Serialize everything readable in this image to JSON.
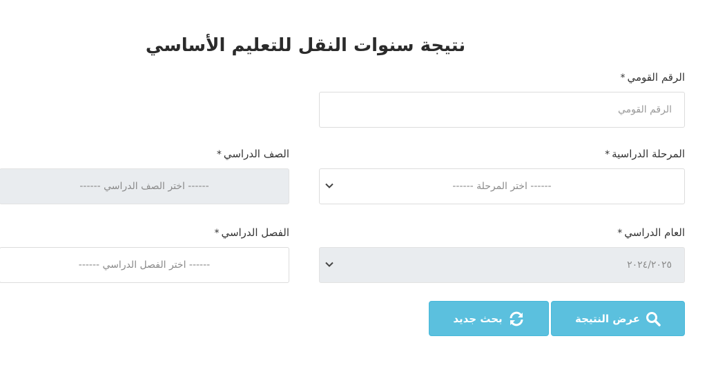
{
  "title": "نتيجة سنوات النقل للتعليم الأساسي",
  "national_id": {
    "label": "الرقم القومي",
    "required_mark": "*",
    "placeholder": "الرقم القومي"
  },
  "stage": {
    "label": "المرحلة الدراسية",
    "required_mark": "*",
    "selected": "------ اختر المرحلة ------"
  },
  "grade": {
    "label": "الصف الدراسي",
    "required_mark": "*",
    "selected": "------ اختر الصف الدراسي ------"
  },
  "academic_year": {
    "label": "العام الدراسي",
    "required_mark": "*",
    "selected": "٢٠٢٤/٢٠٢٥"
  },
  "term": {
    "label": "الفصل الدراسي",
    "required_mark": "*",
    "selected": "------ اختر الفصل الدراسي ------"
  },
  "buttons": {
    "show_result": "عرض النتيجة",
    "new_search": "بحث جديد"
  },
  "colors": {
    "button_bg": "#5bc0de",
    "disabled_bg": "#e9ecef"
  },
  "icons": {
    "show_result": "search-icon",
    "new_search": "refresh-icon",
    "select": "chevron-down-icon"
  }
}
